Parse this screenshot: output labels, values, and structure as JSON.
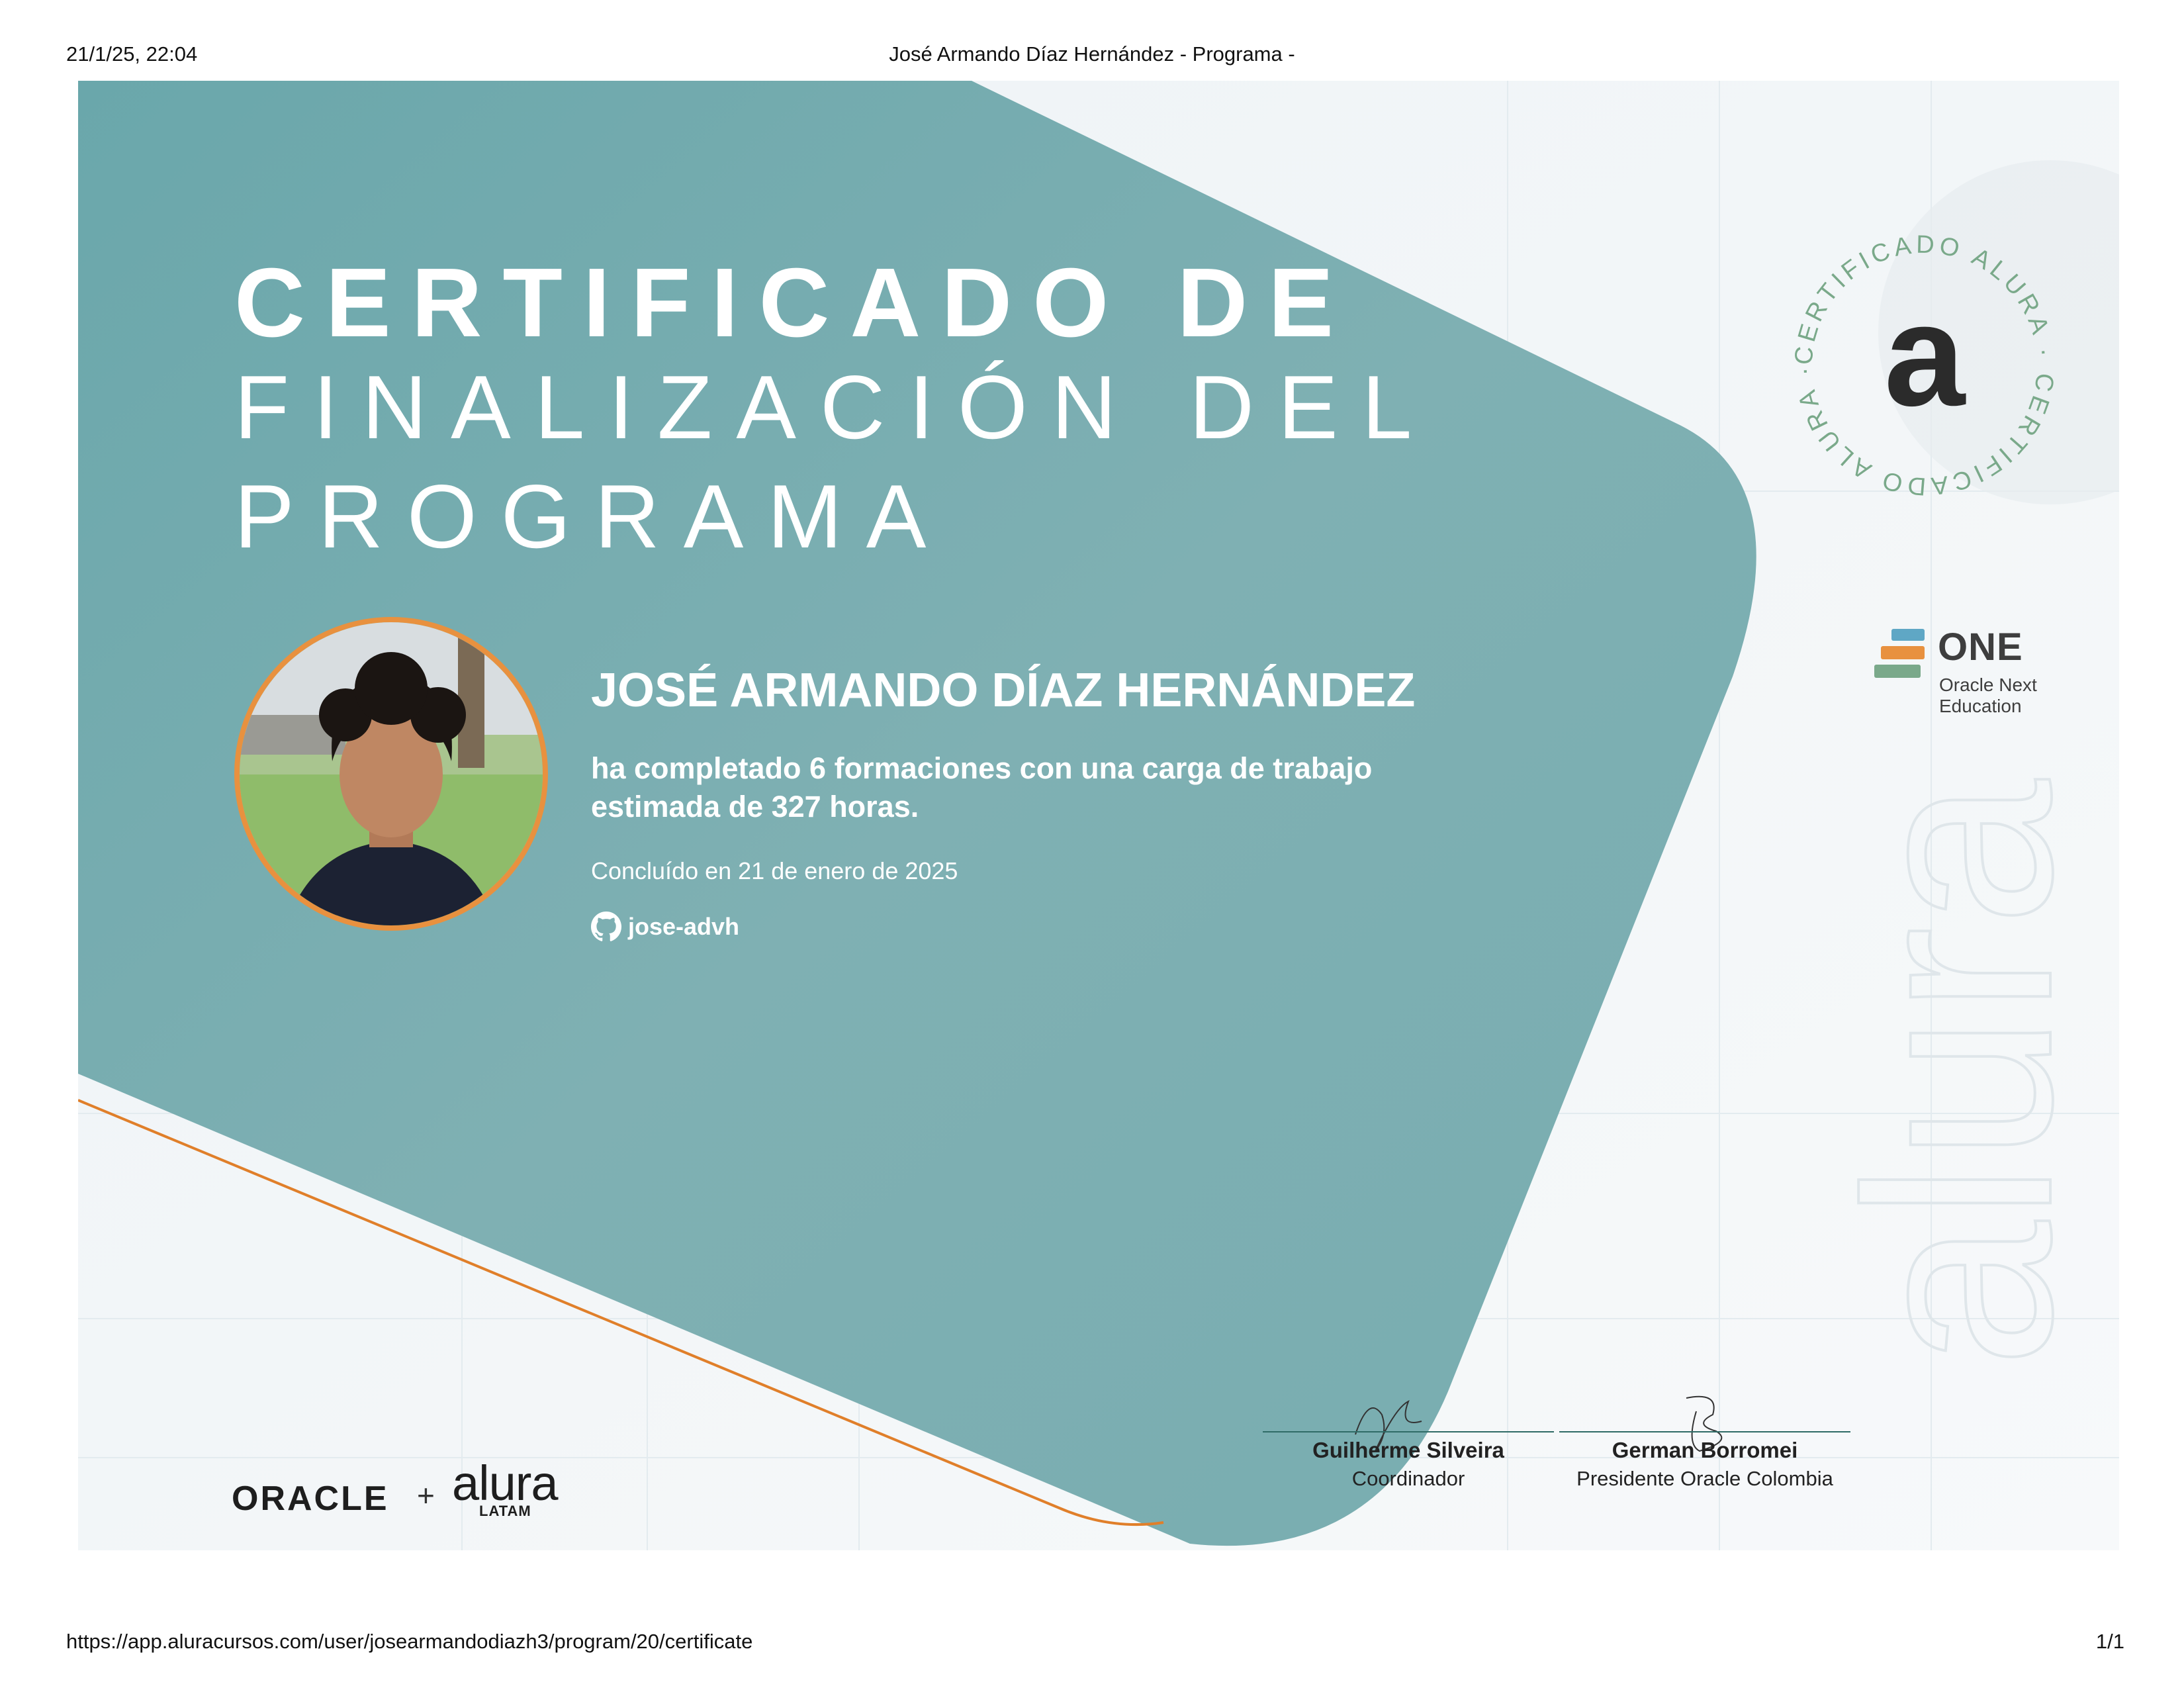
{
  "print_header": {
    "datetime": "21/1/25, 22:04",
    "page_title": "José Armando Díaz Hernández - Programa -"
  },
  "certificate": {
    "title_line1": "CERTIFICADO DE",
    "title_line2": "FINALIZACIÓN DEL",
    "title_line3": "PROGRAMA",
    "student_name": "JOSÉ ARMANDO DÍAZ HERNÁNDEZ",
    "description_line1": "ha completado 6 formaciones con una carga de trabajo",
    "description_line2": "estimada de 327 horas.",
    "completion": "Concluído en 21 de enero de 2025",
    "github_user": "jose-advh",
    "seal": {
      "ring_text": "CERTIFICADO ALURA · CERTIFICADO ALURA ·",
      "letter": "a"
    },
    "one_logo": {
      "word": "ONE",
      "subtitle": "Oracle Next Education"
    },
    "partners": {
      "oracle": "ORACLE",
      "plus": "+",
      "alura": "alura",
      "alura_sub": "LATAM"
    },
    "signatures": [
      {
        "name": "Guilherme Silveira",
        "role": "Coordinador"
      },
      {
        "name": "German Borromei",
        "role": "Presidente Oracle Colombia"
      }
    ],
    "watermark": "alura",
    "colors": {
      "teal": "#79adb0",
      "orange": "#e8913f",
      "seal_green": "#7aa98a"
    }
  },
  "print_footer": {
    "url": "https://app.aluracursos.com/user/josearmandodiazh3/program/20/certificate",
    "page": "1/1"
  }
}
